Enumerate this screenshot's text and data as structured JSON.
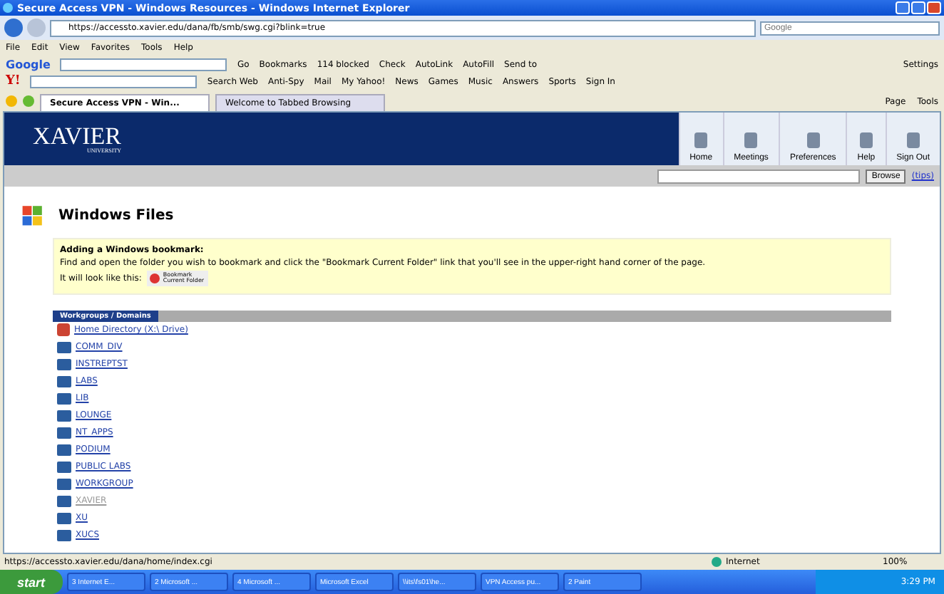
{
  "window": {
    "title": "Secure Access VPN - Windows Resources - Windows Internet Explorer"
  },
  "address_bar": {
    "url": "https://accessto.xavier.edu/dana/fb/smb/swg.cgi?blink=true",
    "search_placeholder": "Google"
  },
  "menu": [
    "File",
    "Edit",
    "View",
    "Favorites",
    "Tools",
    "Help"
  ],
  "google_logo": "Google",
  "yahoo_logo": "Y!",
  "google_toolbar": [
    "Go",
    "Bookmarks",
    "114 blocked",
    "Check",
    "AutoLink",
    "AutoFill",
    "Send to",
    "Settings"
  ],
  "yahoo_toolbar": [
    "Search Web",
    "Anti-Spy",
    "Mail",
    "My Yahoo!",
    "News",
    "Games",
    "Music",
    "Answers",
    "Sports",
    "Sign In"
  ],
  "tabs": [
    {
      "label": "Secure Access VPN - Win...",
      "selected": true
    },
    {
      "label": "Welcome to Tabbed Browsing",
      "selected": false
    }
  ],
  "command_bar": [
    "Page",
    "Tools"
  ],
  "site_header": {
    "logo": "XAVIER",
    "logo_sub": "UNIVERSITY",
    "nav": [
      "Home",
      "Meetings",
      "Preferences",
      "Help",
      "Sign Out"
    ]
  },
  "browse_bar": {
    "button": "Browse",
    "link": "(tips)"
  },
  "heading": "Windows Files",
  "notice": {
    "title": "Adding a Windows bookmark:",
    "text": "Find and open the folder you wish to bookmark and click the \"Bookmark Current Folder\" link that you'll see in the upper-right hand corner of the page.",
    "example_label": "It will look like this:",
    "example_button": "Bookmark Current Folder"
  },
  "list_header": "Workgroups / Domains",
  "items": [
    {
      "kind": "home",
      "label": "Home Directory (X:\\ Drive)",
      "visited": false
    },
    {
      "kind": "domain",
      "label": "COMM_DIV",
      "visited": false
    },
    {
      "kind": "domain",
      "label": "INSTREPTST",
      "visited": false
    },
    {
      "kind": "domain",
      "label": "LABS",
      "visited": false
    },
    {
      "kind": "domain",
      "label": "LIB",
      "visited": false
    },
    {
      "kind": "domain",
      "label": "LOUNGE",
      "visited": false
    },
    {
      "kind": "domain",
      "label": "NT_APPS",
      "visited": false
    },
    {
      "kind": "domain",
      "label": "PODIUM",
      "visited": false
    },
    {
      "kind": "domain",
      "label": "PUBLIC LABS",
      "visited": false
    },
    {
      "kind": "domain",
      "label": "WORKGROUP",
      "visited": false
    },
    {
      "kind": "domain",
      "label": "XAVIER",
      "visited": true
    },
    {
      "kind": "domain",
      "label": "XU",
      "visited": false
    },
    {
      "kind": "domain",
      "label": "XUCS",
      "visited": false
    }
  ],
  "status_bar": {
    "url": "https://accessto.xavier.edu/dana/home/index.cgi",
    "zone": "Internet",
    "zoom": "100%"
  },
  "taskbar": {
    "start": "start",
    "items": [
      "3 Internet E...",
      "2 Microsoft ...",
      "4 Microsoft ...",
      "Microsoft Excel",
      "\\\\its\\fs01\\he...",
      "VPN Access pu...",
      "2 Paint"
    ],
    "clock": "3:29 PM"
  }
}
